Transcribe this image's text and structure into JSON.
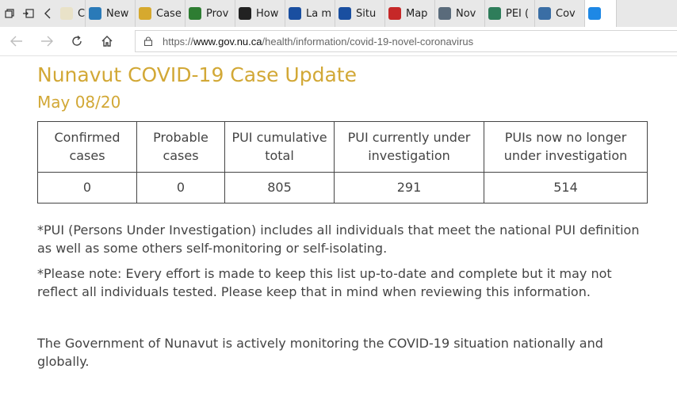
{
  "browser": {
    "tabs": [
      {
        "label": "Case",
        "favicon_color": "#e9e2c8"
      },
      {
        "label": "New",
        "favicon_color": "#2a7ab8"
      },
      {
        "label": "Case",
        "favicon_color": "#d6a92e"
      },
      {
        "label": "Prov",
        "favicon_color": "#2e7d32"
      },
      {
        "label": "How",
        "favicon_color": "#222222"
      },
      {
        "label": "La m",
        "favicon_color": "#1a4fa0"
      },
      {
        "label": "Situ",
        "favicon_color": "#1a4fa0"
      },
      {
        "label": "Map",
        "favicon_color": "#c62828"
      },
      {
        "label": "Nov",
        "favicon_color": "#5a6b7b"
      },
      {
        "label": "PEI (",
        "favicon_color": "#2e7d5a"
      },
      {
        "label": "Cov",
        "favicon_color": "#3a6ea5"
      },
      {
        "label": "",
        "favicon_color": "#1e88e5"
      }
    ],
    "url_prefix": "https://",
    "url_domain": "www.gov.nu.ca",
    "url_path": "/health/information/covid-19-novel-coronavirus"
  },
  "page": {
    "title": "Nunavut COVID-19 Case Update",
    "date": "May 08/20",
    "table": {
      "headers": [
        "Confirmed cases",
        "Probable cases",
        "PUI cumulative total",
        "PUI currently under investigation",
        "PUIs now no longer under investigation"
      ],
      "values": [
        "0",
        "0",
        "805",
        "291",
        "514"
      ]
    },
    "note_pui": "*PUI (Persons Under Investigation) includes all individuals that meet the national PUI definition as well as some others self-monitoring or self-isolating.",
    "note_please": "*Please note: Every effort is made to keep this list up-to-date and complete but it may not reflect all individuals tested. Please keep that in mind when reviewing this information.",
    "monitoring": "The Government of Nunavut is actively monitoring the COVID-19 situation nationally and globally."
  }
}
